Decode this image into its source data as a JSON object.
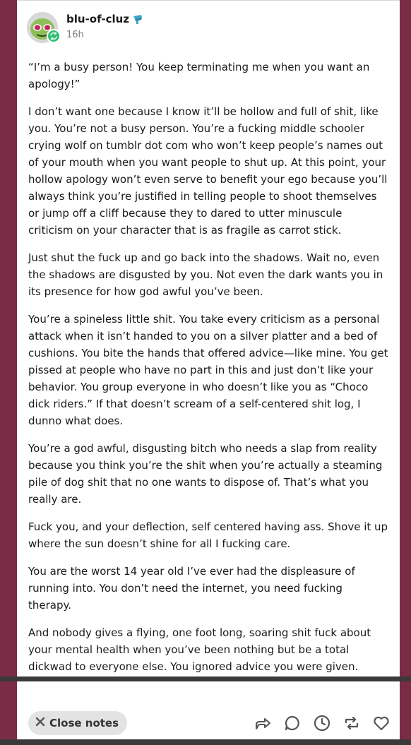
{
  "post": {
    "author": "blu-of-cluz",
    "time": "16h",
    "paragraphs": [
      "“I’m a busy person! You keep terminating me when you want an apology!”",
      "I don’t want one because I know it’ll be hollow and full of shit, like you. You’re not a busy person. You’re a fucking middle schooler crying wolf on tumblr dot com who won’t keep people’s names out of your mouth when you want people to shut up. At this point, your hollow apology won’t even serve to benefit your ego because you’ll always think you’re justified in telling people to shoot themselves or jump off a cliff because they to dared to utter minuscule criticism on your character that is as fragile as carrot stick.",
      "Just shut the fuck up and go back into the shadows. Wait no, even the shadows are disgusted by you. Not even the dark wants you in its presence for how god awful you’ve been.",
      "You’re a spineless little shit. You take every criticism as a personal attack when it isn’t handed to you on a silver platter and a bed of cushions. You bite the hands that offered advice—like mine. You get pissed at people who have no part in this and just don’t like your behavior. You group everyone in who doesn’t like you as “Choco dick riders.” If that doesn’t scream of a self-centered shit log, I dunno what does.",
      "You’re a god awful, disgusting bitch who needs a slap from reality because you think you’re the shit when you’re actually a steaming pile of dog shit that no one wants to dispose of. That’s what you really are.",
      "Fuck you, and your deflection, self centered having ass. Shove it up where the sun doesn’t shine for all I fucking care.",
      "You are the worst 14 year old I’ve ever had the displeasure of running into. You don’t need the internet, you need fucking therapy.",
      "And nobody gives a flying, one foot long, soaring shit fuck about your mental health when you’ve been nothing but be a total dickwad to everyone else. You ignored advice you were given. Instead of using it, you crumpled it up and threw it to the side like a shitty report card."
    ]
  },
  "footer": {
    "close_notes_label": "Close notes",
    "actions": [
      "share-icon",
      "reply-icon",
      "schedule-icon",
      "reblog-icon",
      "like-icon"
    ]
  },
  "colors": {
    "background": "#7a2b45",
    "reblog_badge": "#2fbf71",
    "close_button_bg": "#e3e3e3"
  }
}
